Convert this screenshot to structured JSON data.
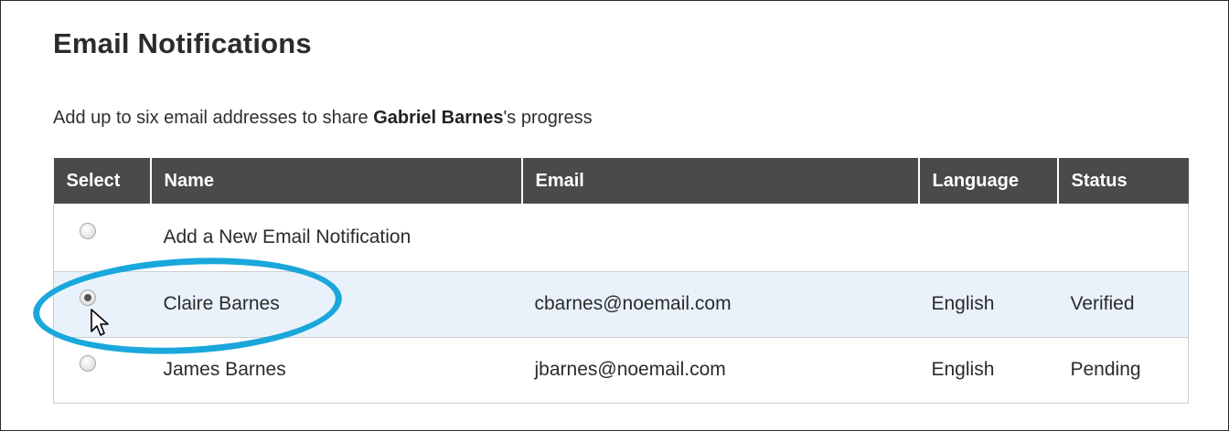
{
  "heading": "Email Notifications",
  "intro": {
    "prefix": "Add up to six email addresses to share ",
    "student_name": "Gabriel Barnes",
    "suffix": "'s progress"
  },
  "table": {
    "headers": {
      "select": "Select",
      "name": "Name",
      "email": "Email",
      "language": "Language",
      "status": "Status"
    },
    "add_new_label": "Add a New Email Notification",
    "rows": [
      {
        "name": "Claire Barnes",
        "email": "cbarnes@noemail.com",
        "language": "English",
        "status": "Verified",
        "selected": true
      },
      {
        "name": "James Barnes",
        "email": "jbarnes@noemail.com",
        "language": "English",
        "status": "Pending",
        "selected": false
      }
    ]
  },
  "colors": {
    "header_bg": "#4a4a4a",
    "selected_row_bg": "#e9f2fa",
    "annotation_ring": "#1aa7dc"
  },
  "icons": {
    "cursor": "mouse-pointer-icon",
    "annotation": "highlight-ellipse"
  }
}
